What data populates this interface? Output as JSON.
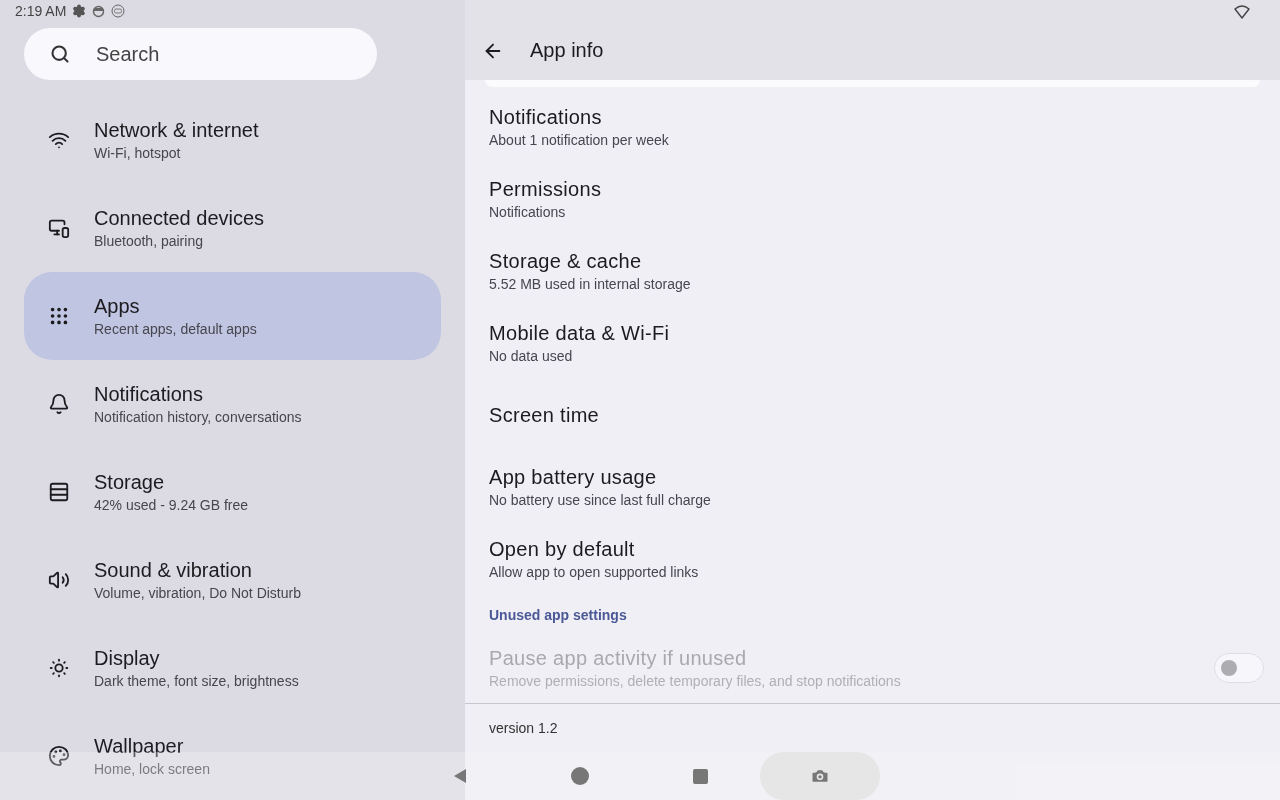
{
  "status_bar": {
    "time": "2:19 AM"
  },
  "search": {
    "placeholder": "Search"
  },
  "sidebar": {
    "items": [
      {
        "title": "Network & internet",
        "subtitle": "Wi-Fi, hotspot",
        "selected": false
      },
      {
        "title": "Connected devices",
        "subtitle": "Bluetooth, pairing",
        "selected": false
      },
      {
        "title": "Apps",
        "subtitle": "Recent apps, default apps",
        "selected": true
      },
      {
        "title": "Notifications",
        "subtitle": "Notification history, conversations",
        "selected": false
      },
      {
        "title": "Storage",
        "subtitle": "42% used - 9.24 GB free",
        "selected": false
      },
      {
        "title": "Sound & vibration",
        "subtitle": "Volume, vibration, Do Not Disturb",
        "selected": false
      },
      {
        "title": "Display",
        "subtitle": "Dark theme, font size, brightness",
        "selected": false
      },
      {
        "title": "Wallpaper",
        "subtitle": "Home, lock screen",
        "selected": false
      }
    ]
  },
  "app_info": {
    "title": "App info",
    "items": [
      {
        "kind": "item",
        "title": "Notifications",
        "subtitle": "About 1 notification per week"
      },
      {
        "kind": "item",
        "title": "Permissions",
        "subtitle": "Notifications"
      },
      {
        "kind": "item",
        "title": "Storage & cache",
        "subtitle": "5.52 MB used in internal storage"
      },
      {
        "kind": "item",
        "title": "Mobile data & Wi-Fi",
        "subtitle": "No data used"
      },
      {
        "kind": "item",
        "title": "Screen time"
      },
      {
        "kind": "item",
        "title": "App battery usage",
        "subtitle": "No battery use since last full charge"
      },
      {
        "kind": "item",
        "title": "Open by default",
        "subtitle": "Allow app to open supported links"
      },
      {
        "kind": "header",
        "title": "Unused app settings"
      },
      {
        "kind": "switch",
        "title": "Pause app activity if unused",
        "subtitle": "Remove permissions, delete temporary files, and stop notifications",
        "on": false,
        "disabled": true
      }
    ],
    "version": "version 1.2"
  }
}
